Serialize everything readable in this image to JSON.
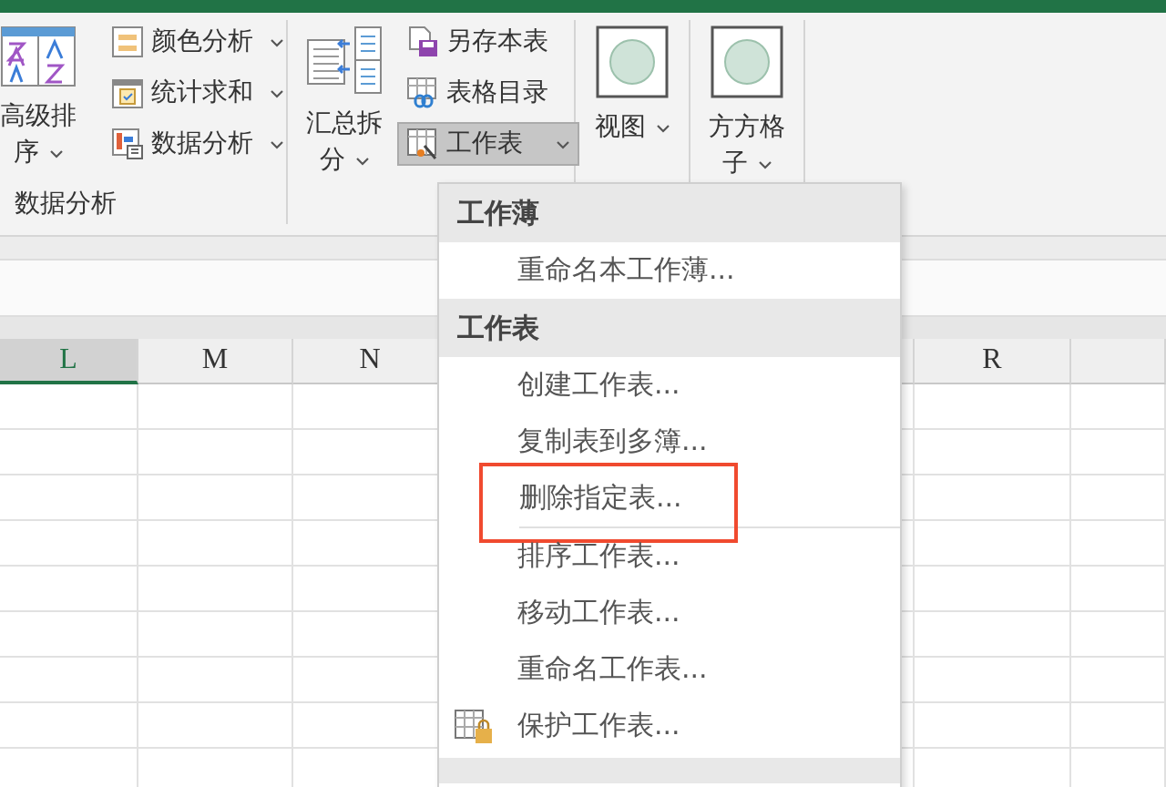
{
  "ribbon": {
    "groups": [
      {
        "label": "数据分析",
        "large": {
          "label": "高级排序",
          "dropdown": true,
          "pressed": false
        },
        "small": [
          {
            "label": "颜色分析",
            "dropdown": true,
            "pressed": false
          },
          {
            "label": "统计求和",
            "dropdown": true,
            "pressed": false
          },
          {
            "label": "数据分析",
            "dropdown": true,
            "pressed": false
          }
        ]
      },
      {
        "large": {
          "label": "汇总拆分",
          "dropdown": true,
          "pressed": false
        },
        "small": [
          {
            "label": "另存本表",
            "dropdown": false,
            "pressed": false
          },
          {
            "label": "表格目录",
            "dropdown": false,
            "pressed": false
          },
          {
            "label": "工作表",
            "dropdown": true,
            "pressed": true
          }
        ]
      },
      {
        "large": {
          "label": "视图",
          "dropdown": true,
          "pressed": false
        }
      },
      {
        "large": {
          "label": "方方格子",
          "dropdown": true,
          "pressed": false
        }
      }
    ]
  },
  "sheet": {
    "columns": [
      {
        "label": "L",
        "selected": true
      },
      {
        "label": "M",
        "selected": false
      },
      {
        "label": "N",
        "selected": false
      },
      {
        "label": "R",
        "selected": false
      }
    ]
  },
  "menu": {
    "sections": [
      {
        "header": "工作薄",
        "items": [
          {
            "label": "重命名本工作薄...",
            "kind": "plain",
            "highlighted": false,
            "separator_after": false
          }
        ]
      },
      {
        "header": "工作表",
        "items": [
          {
            "label": "创建工作表...",
            "kind": "plain",
            "highlighted": false,
            "separator_after": false
          },
          {
            "label": "复制表到多簿...",
            "kind": "plain",
            "highlighted": false,
            "separator_after": false
          },
          {
            "label": "删除指定表...",
            "kind": "plain",
            "highlighted": true,
            "separator_after": true
          },
          {
            "label": "排序工作表...",
            "kind": "plain",
            "highlighted": false,
            "separator_after": false
          },
          {
            "label": "移动工作表...",
            "kind": "plain",
            "highlighted": false,
            "separator_after": false
          },
          {
            "label": "重命名工作表...",
            "kind": "plain",
            "highlighted": false,
            "separator_after": false
          },
          {
            "label": "保护工作表...",
            "kind": "lock",
            "highlighted": false,
            "separator_after": false
          }
        ]
      }
    ]
  }
}
